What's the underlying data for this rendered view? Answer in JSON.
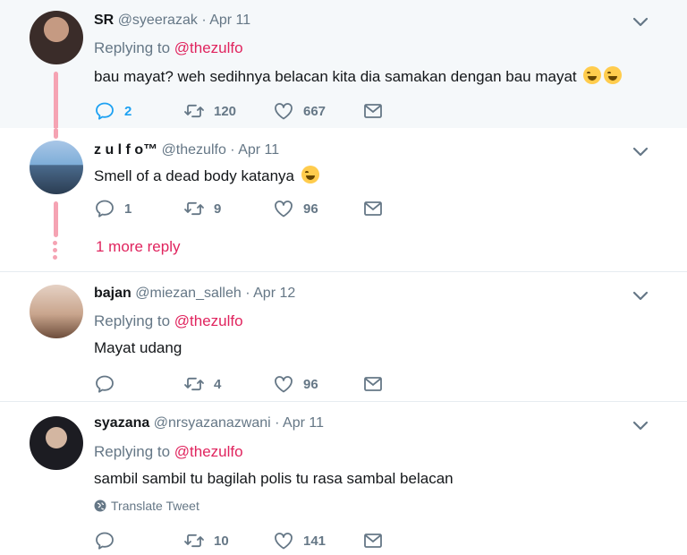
{
  "tweets": [
    {
      "name": "SR",
      "handle": "@syeerazak",
      "date": "Apr 11",
      "replying_prefix": "Replying to",
      "replying_to": "@thezulfo",
      "text": "bau mayat? weh sedihnya belacan kita dia samakan dengan bau mayat",
      "replies": "2",
      "retweets": "120",
      "likes": "667"
    },
    {
      "name": "z u l f o™",
      "handle": "@thezulfo",
      "date": "Apr 11",
      "text": "Smell of a dead body katanya",
      "replies": "1",
      "retweets": "9",
      "likes": "96",
      "more_replies": "1 more reply"
    },
    {
      "name": "bajan",
      "handle": "@miezan_salleh",
      "date": "Apr 12",
      "replying_prefix": "Replying to",
      "replying_to": "@thezulfo",
      "text": "Mayat udang",
      "replies": "",
      "retweets": "4",
      "likes": "96"
    },
    {
      "name": "syazana",
      "handle": "@nrsyazanazwani",
      "date": "Apr 11",
      "replying_prefix": "Replying to",
      "replying_to": "@thezulfo",
      "text": "sambil sambil tu bagilah polis tu rasa sambal belacan",
      "translate": "Translate Tweet",
      "replies": "",
      "retweets": "10",
      "likes": "141"
    }
  ],
  "separator": "·",
  "colors": {
    "accent_blue": "#1da1f2",
    "mention_red": "#e0245e",
    "muted": "#657786",
    "thread_line": "#f5a3b3"
  },
  "icons": [
    "reply-icon",
    "retweet-icon",
    "like-icon",
    "direct-message-icon",
    "chevron-down-icon",
    "globe-icon",
    "face-with-tears-of-joy-emoji"
  ]
}
